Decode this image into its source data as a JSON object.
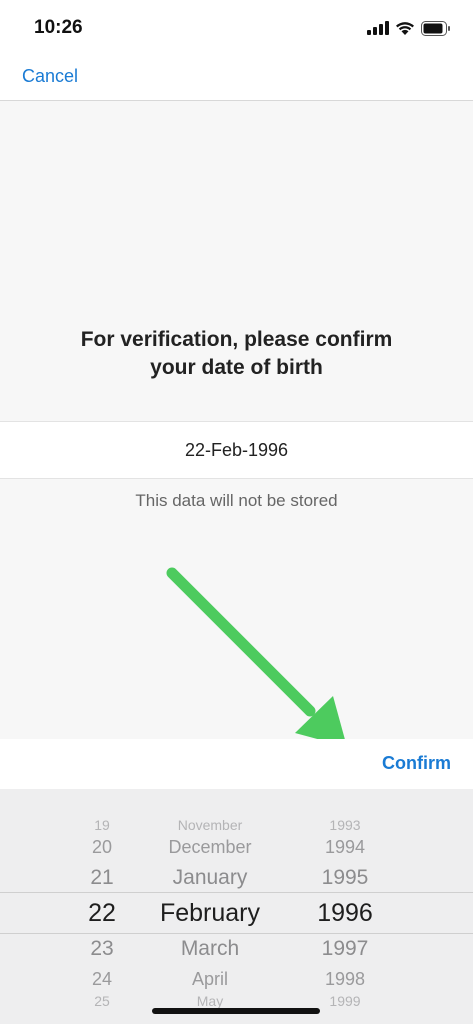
{
  "status": {
    "time": "10:26"
  },
  "nav": {
    "cancel_label": "Cancel"
  },
  "prompt": {
    "line1": "For verification, please confirm",
    "line2": "your date of birth"
  },
  "date_field": {
    "value": "22-Feb-1996"
  },
  "note": "This data will not be stored",
  "toolbar": {
    "confirm_label": "Confirm"
  },
  "picker": {
    "days": [
      "19",
      "20",
      "21",
      "22",
      "23",
      "24",
      "25"
    ],
    "months": [
      "November",
      "December",
      "January",
      "February",
      "March",
      "April",
      "May"
    ],
    "years": [
      "1993",
      "1994",
      "1995",
      "1996",
      "1997",
      "1998",
      "1999"
    ],
    "selected": {
      "day": "22",
      "month": "February",
      "year": "1996"
    }
  },
  "colors": {
    "accent": "#1a7bd4",
    "arrow": "#4dcb5e"
  }
}
